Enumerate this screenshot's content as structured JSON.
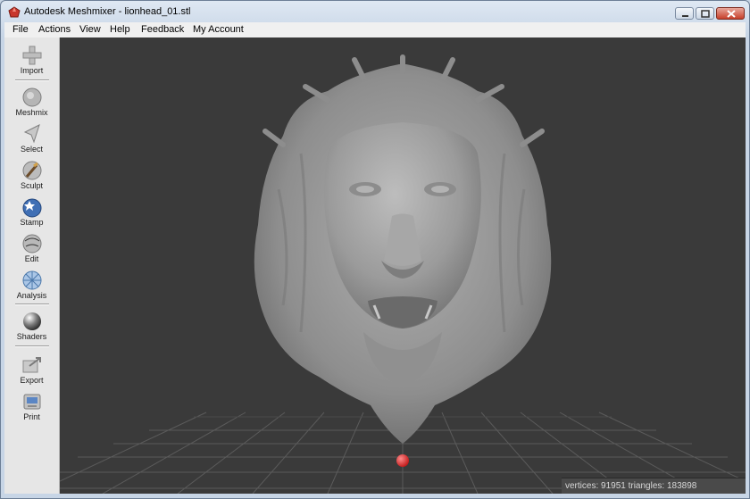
{
  "window": {
    "title": "Autodesk Meshmixer - lionhead_01.stl"
  },
  "menu": [
    "File",
    "Actions",
    "View",
    "Help",
    "Feedback",
    "My Account"
  ],
  "tools": [
    {
      "label": "Import",
      "icon": "plus-icon"
    },
    {
      "label": "Meshmix",
      "icon": "meshmix-sphere-icon"
    },
    {
      "label": "Select",
      "icon": "cursor-arrow-icon"
    },
    {
      "label": "Sculpt",
      "icon": "brush-icon"
    },
    {
      "label": "Stamp",
      "icon": "stamp-icon"
    },
    {
      "label": "Edit",
      "icon": "edit-sphere-icon"
    },
    {
      "label": "Analysis",
      "icon": "analysis-sphere-icon"
    },
    {
      "label": "Shaders",
      "icon": "shader-sphere-icon"
    },
    {
      "label": "Export",
      "icon": "export-icon"
    },
    {
      "label": "Print",
      "icon": "printer-icon"
    }
  ],
  "status": {
    "text": "vertices: 91951  triangles: 183898"
  },
  "colors": {
    "viewport_bg": "#3a3a3a",
    "grid": "#5b5b5b",
    "mesh": "#9a9a9a",
    "pivot": "#e03030",
    "toolbar_bg": "#e6e6e6"
  }
}
